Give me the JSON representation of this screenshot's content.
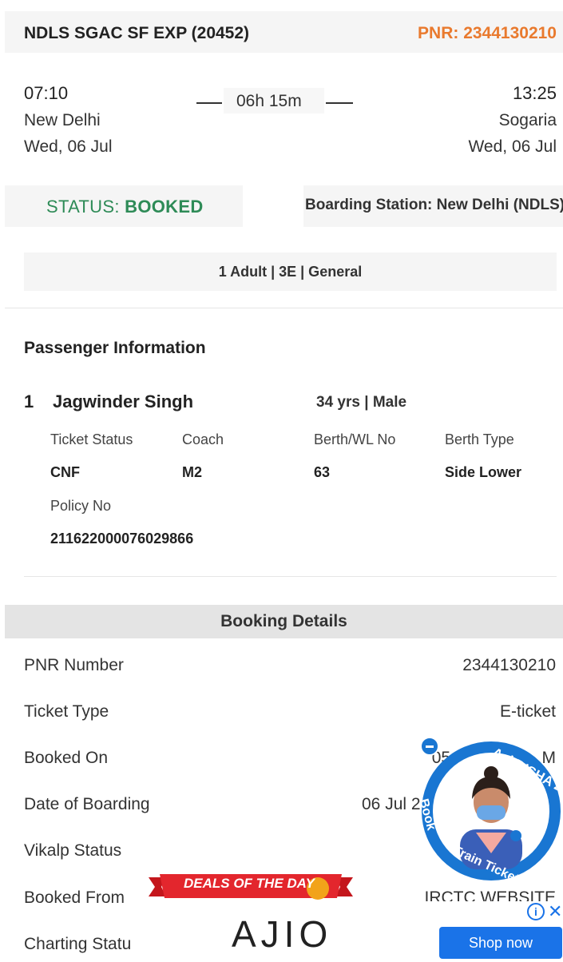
{
  "journey": {
    "train": "NDLS SGAC SF EXP (20452)",
    "pnr_header": "PNR: 2344130210",
    "departure_time": "07:10",
    "departure_city": "New Delhi",
    "departure_date": "Wed, 06 Jul",
    "duration": "06h 15m",
    "arrival_time": "13:25",
    "arrival_city": "Sogaria",
    "arrival_date": "Wed, 06 Jul"
  },
  "status": {
    "label": "STATUS: ",
    "value": "BOOKED",
    "boarding": "Boarding Station: New Delhi (NDLS)"
  },
  "fare_summary": "1 Adult | 3E | General",
  "passenger_section": {
    "title": "Passenger Information",
    "number": "1",
    "name": "Jagwinder Singh",
    "age_gender": "34 yrs | Male",
    "fields": {
      "ticket_status_label": "Ticket Status",
      "ticket_status": "CNF",
      "coach_label": "Coach",
      "coach": "M2",
      "berth_label": "Berth/WL No",
      "berth": "63",
      "berth_type_label": "Berth Type",
      "berth_type": "Side Lower",
      "policy_label": "Policy No",
      "policy": "211622000076029866"
    }
  },
  "booking": {
    "title": "Booking Details",
    "rows": [
      {
        "label": "PNR Number",
        "value": "2344130210"
      },
      {
        "label": "Ticket Type",
        "value": "E-ticket"
      },
      {
        "label": "Booked On",
        "value": "05 Jul 2022 ... M"
      },
      {
        "label": "Date of Boarding",
        "value": "06 Jul 2"
      },
      {
        "label": "Vikalp Status",
        "value": ""
      },
      {
        "label": "Booked From",
        "value": "IRCTC WEBSITE"
      },
      {
        "label": "Charting Statu",
        "value": ""
      }
    ]
  },
  "ad": {
    "deals": "DEALS OF THE DAY",
    "brand": "AJIO",
    "cta": "Shop now",
    "info": "i",
    "close": "✕"
  },
  "disha": {
    "title": "AskDISHA 2.0",
    "sub1": "Book",
    "sub2": "Train Ticket"
  },
  "colors": {
    "accent_orange": "#e97a2e",
    "status_green": "#2e8b57",
    "disha_blue": "#1976d2",
    "ad_button": "#1a73e8"
  }
}
